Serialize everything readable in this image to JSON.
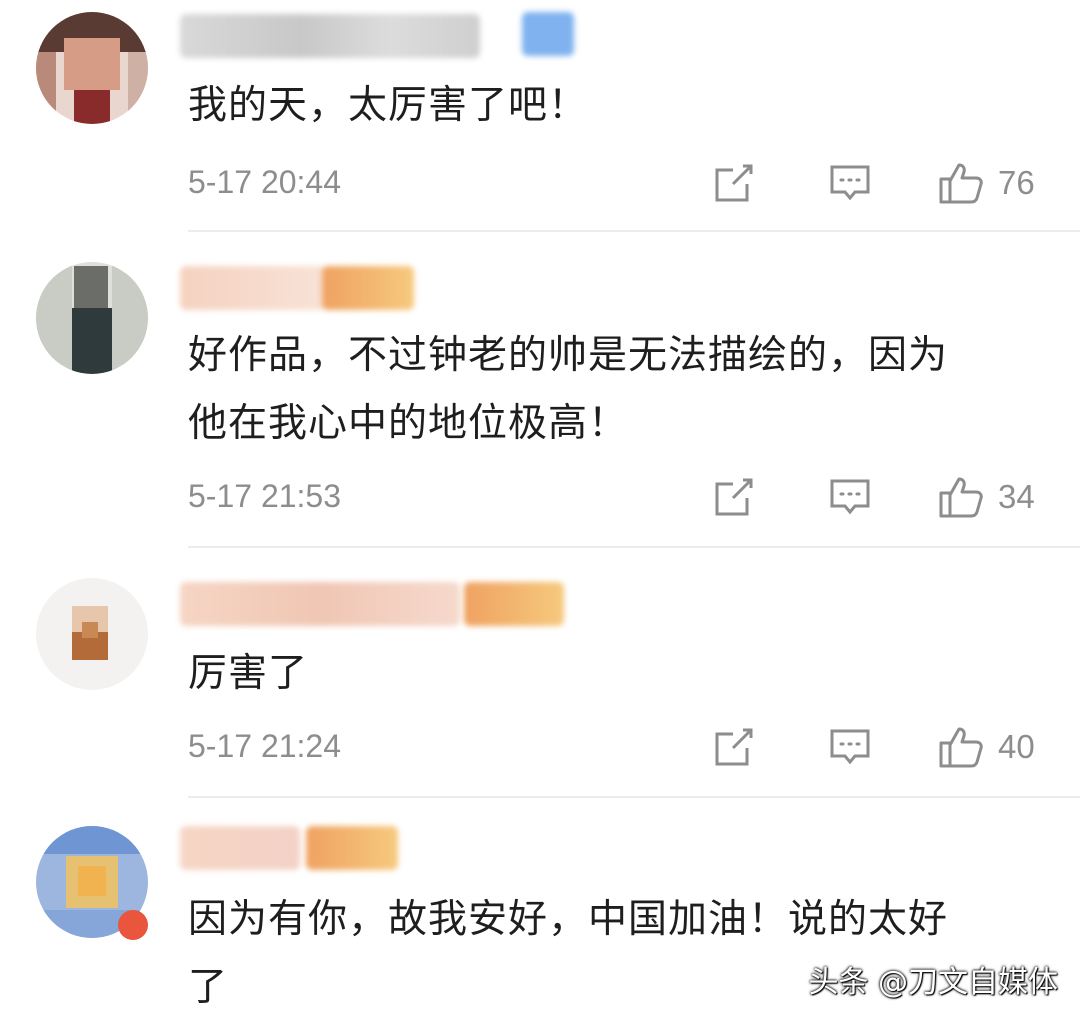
{
  "comments": [
    {
      "text_lines": [
        "我的天，太厉害了吧！"
      ],
      "time": "5-17 20:44",
      "likes": "76"
    },
    {
      "text_lines": [
        "好作品，不过钟老的帅是无法描绘的，因为",
        "他在我心中的地位极高！"
      ],
      "time": "5-17 21:53",
      "likes": "34"
    },
    {
      "text_lines": [
        "厉害了"
      ],
      "time": "5-17 21:24",
      "likes": "40"
    },
    {
      "text_lines": [
        "因为有你，故我安好，中国加油！说的太好",
        "了"
      ]
    }
  ],
  "icons": {
    "share": "share-icon",
    "reply": "comment-icon",
    "like": "thumbs-up-icon"
  },
  "watermark": "头条 @刀文自媒体",
  "colors": {
    "meta_gray": "#8d8d8d",
    "badge_orange": "#f5b35a",
    "badge_blue": "#7fb2ef"
  }
}
